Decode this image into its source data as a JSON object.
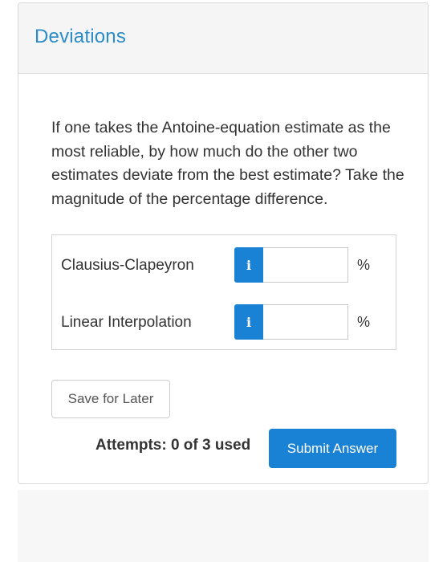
{
  "card": {
    "title": "Deviations"
  },
  "question": {
    "text": "If one takes the Antoine-equation estimate as the most reliable, by how much do the other two estimates deviate from the best estimate? Take the magnitude of the percentage difference."
  },
  "answers": [
    {
      "label": "Clausius-Clapeyron",
      "info": "i",
      "value": "",
      "unit": "%"
    },
    {
      "label": "Linear Interpolation",
      "info": "i",
      "value": "",
      "unit": "%"
    }
  ],
  "actions": {
    "save_label": "Save for Later",
    "attempts_text": "Attempts: 0 of 3 used",
    "submit_label": "Submit Answer"
  },
  "colors": {
    "accent": "#1a82d4",
    "title": "#2a8cc8"
  }
}
